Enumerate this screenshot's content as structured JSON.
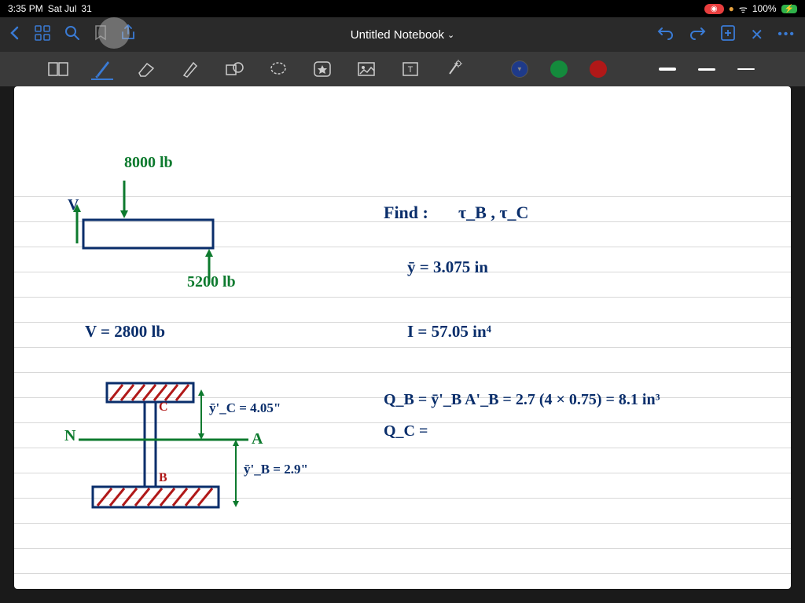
{
  "status": {
    "time": "3:35 PM",
    "day": "Sat Jul",
    "date": "31",
    "battery": "100%",
    "rec": "◉"
  },
  "nav": {
    "title": "Untitled Notebook",
    "chevron": "⌄"
  },
  "tools": {
    "colors": {
      "blue": "#1e3a8a",
      "green": "#148a3c",
      "red": "#b01818"
    }
  },
  "notes": {
    "load1": "8000 lb",
    "load2": "5200 lb",
    "v_label": "V",
    "v_eq": "V = 2800 lb",
    "find": "Find :",
    "find_vals": "τ_B , τ_C",
    "ybar": "ȳ = 3.075 in",
    "I": "I = 57.05 in⁴",
    "QB": "Q_B = ȳ'_B A'_B = 2.7 (4 × 0.75) = 8.1 in³",
    "QC": "Q_C =",
    "N": "N",
    "A": "A",
    "B": "B",
    "C": "C",
    "yc": "ȳ'_C = 4.05\"",
    "yb": "ȳ'_B = 2.9\""
  }
}
